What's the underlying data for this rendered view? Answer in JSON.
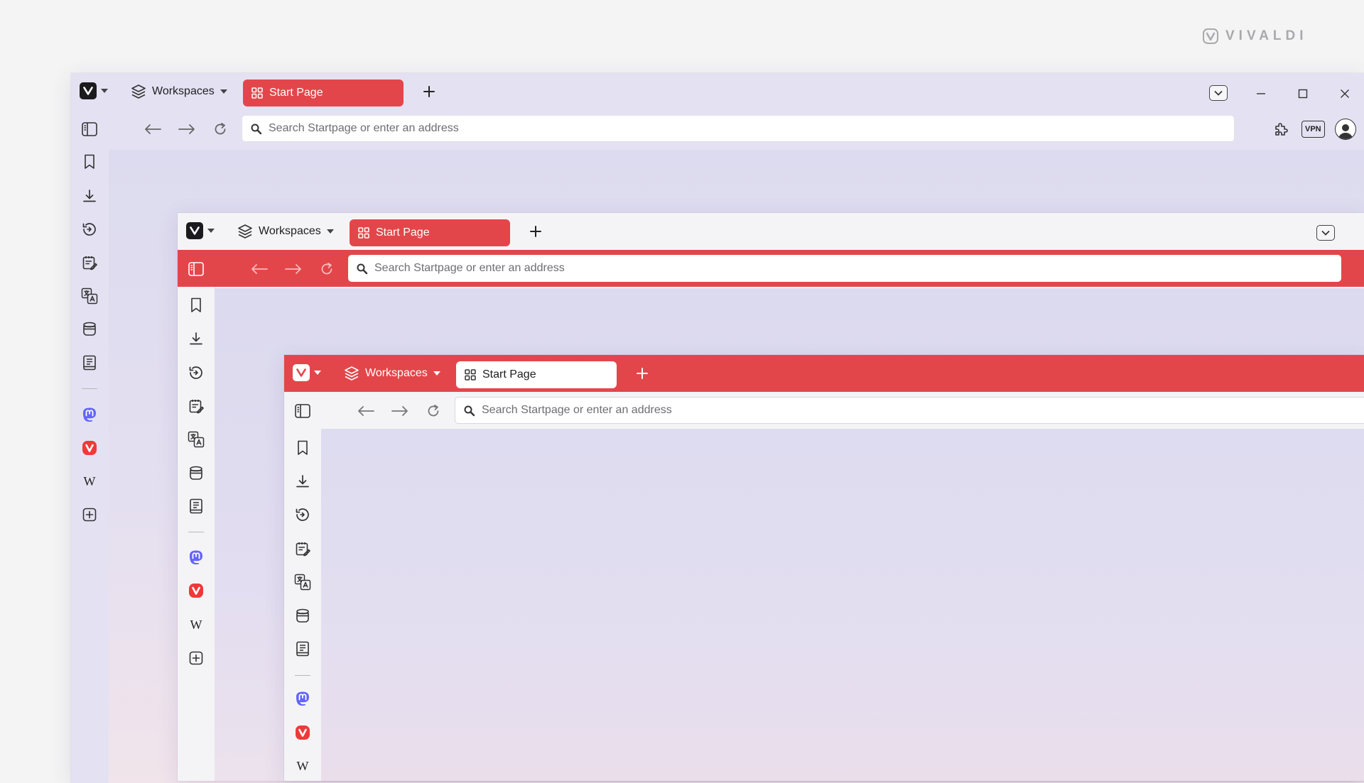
{
  "brand": {
    "name": "VIVALDI"
  },
  "tabbar": {
    "workspaces_label": "Workspaces",
    "tab_title": "Start Page"
  },
  "address": {
    "placeholder": "Search Startpage or enter an address"
  },
  "toolbar": {
    "vpn_label": "VPN"
  },
  "panel": {
    "wikipedia_label": "W"
  },
  "colors": {
    "accent": "#e3464a",
    "background": "#f4f4f4",
    "content_tint": "#dddbef"
  }
}
